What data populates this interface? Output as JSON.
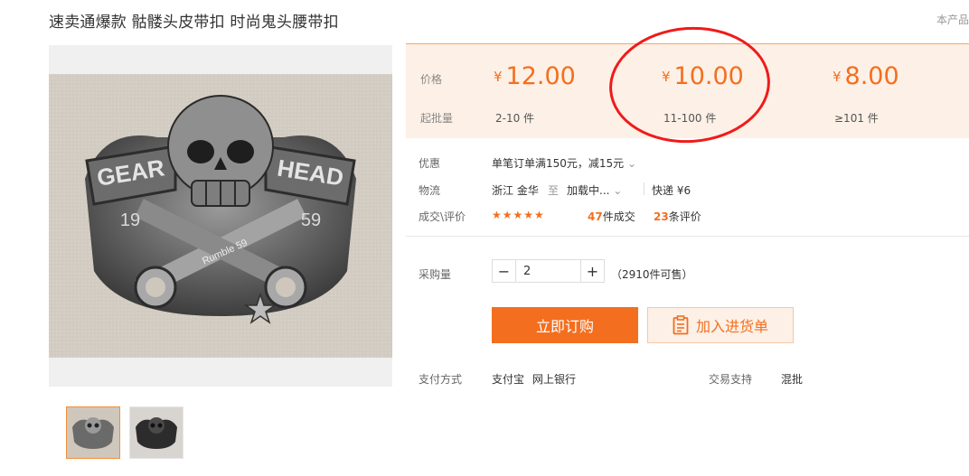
{
  "product": {
    "title": "速卖通爆款 骷髅头皮带扣 时尚鬼头腰带扣",
    "corner_text": "本产品"
  },
  "gallery": {
    "image_text": {
      "left": "GEAR",
      "right": "HEAD",
      "year_left": "19",
      "year_right": "59",
      "banner": "Rumble 59"
    }
  },
  "pricing": {
    "price_label": "价格",
    "min_order_label": "起批量",
    "currency": "¥",
    "tiers": [
      {
        "price": "12.00",
        "range": "2-10 件"
      },
      {
        "price": "10.00",
        "range": "11-100 件"
      },
      {
        "price": "8.00",
        "range": "≥101 件"
      }
    ]
  },
  "discount": {
    "label": "优惠",
    "text": "单笔订单满150元，减15元"
  },
  "logistics": {
    "label": "物流",
    "from": "浙江 金华",
    "to_word": "至",
    "destination": "加载中...",
    "shipping": "快递 ¥6"
  },
  "reviews": {
    "label": "成交\\评价",
    "stars": "★★★★★",
    "deals_count": "47",
    "deals_unit": "件成交",
    "review_count": "23",
    "review_unit": "条评价"
  },
  "quantity": {
    "label": "采购量",
    "minus": "−",
    "value": "2",
    "plus": "+",
    "available": "（2910件可售）"
  },
  "actions": {
    "buy_now": "立即订购",
    "add_to_cart": "加入进货单"
  },
  "payment": {
    "label": "支付方式",
    "methods": [
      "支付宝",
      "网上银行"
    ],
    "support_label": "交易支持",
    "support_value": "混批"
  },
  "colors": {
    "accent": "#f36f1f",
    "price_bg": "#fdf0e6",
    "annotation_circle": "#ef1b1b"
  }
}
